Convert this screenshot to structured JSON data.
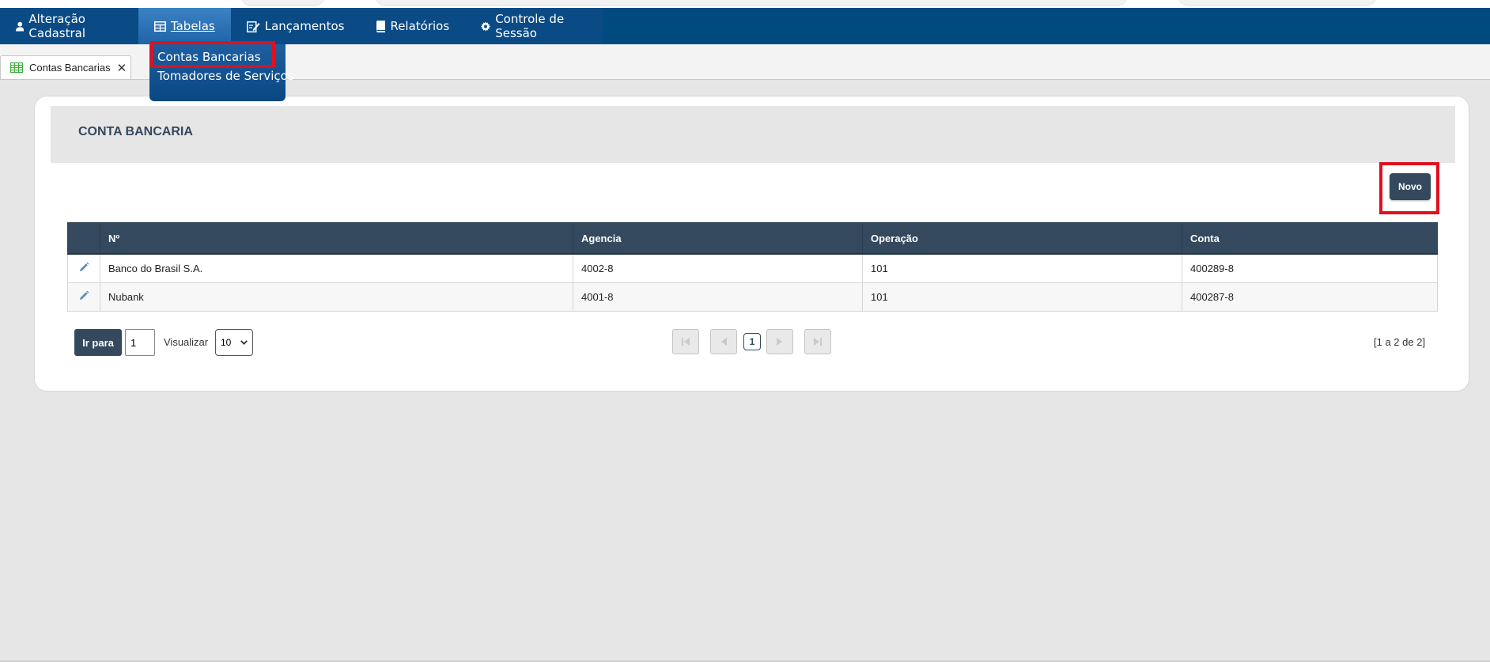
{
  "nav": {
    "items": [
      {
        "label": "Alteração Cadastral",
        "icon": "user-icon"
      },
      {
        "label": "Tabelas",
        "icon": "table-icon"
      },
      {
        "label": "Lançamentos",
        "icon": "edit-document-icon"
      },
      {
        "label": "Relatórios",
        "icon": "book-icon"
      },
      {
        "label": "Controle de Sessão",
        "icon": "gear-icon"
      }
    ],
    "dropdown": {
      "items": [
        {
          "label": "Contas Bancarias"
        },
        {
          "label": "Tomadores de Serviços"
        }
      ]
    }
  },
  "tabs": [
    {
      "label": "Contas Bancarias",
      "icon": "grid-icon"
    }
  ],
  "page": {
    "title": "CONTA BANCARIA",
    "new_button": "Novo"
  },
  "table": {
    "columns": [
      "Nº",
      "Agencia",
      "Operação",
      "Conta"
    ],
    "rows": [
      {
        "numero": "Banco do Brasil S.A.",
        "agencia": "4002-8",
        "operacao": "101",
        "conta": "400289-8"
      },
      {
        "numero": "Nubank",
        "agencia": "4001-8",
        "operacao": "101",
        "conta": "400287-8"
      }
    ]
  },
  "pagination": {
    "goto_label": "Ir para",
    "page_input": "1",
    "view_label": "Visualizar",
    "page_size": "10",
    "current_page": "1",
    "range_text": "[1 a 2 de 2]"
  },
  "colors": {
    "navbar": "#004a80",
    "header_dark": "#34495e",
    "highlight": "#e0101e"
  }
}
